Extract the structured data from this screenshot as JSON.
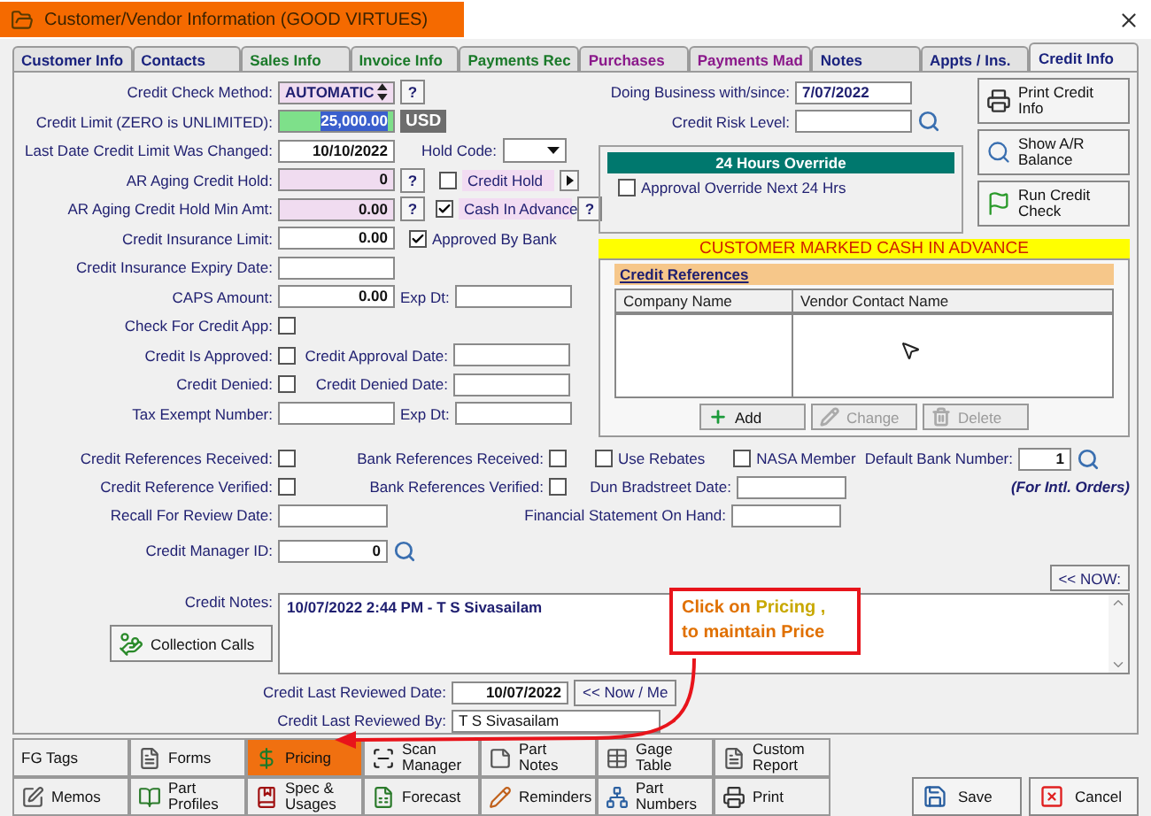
{
  "window": {
    "title": "Customer/Vendor Information  (GOOD VIRTUES)"
  },
  "tabs": [
    {
      "label": "Customer Info",
      "color": "#1a237e",
      "selected": false
    },
    {
      "label": "Contacts",
      "color": "#1a237e",
      "selected": false
    },
    {
      "label": "Sales Info",
      "color": "#1b7a2a",
      "selected": false
    },
    {
      "label": "Invoice Info",
      "color": "#1b7a2a",
      "selected": false
    },
    {
      "label": "Payments Rec",
      "color": "#1b7a2a",
      "selected": false
    },
    {
      "label": "Purchases",
      "color": "#8b1a8b",
      "selected": false
    },
    {
      "label": "Payments Mad",
      "color": "#8b1a8b",
      "selected": false
    },
    {
      "label": "Notes",
      "color": "#1a237e",
      "selected": false
    },
    {
      "label": "Appts / Ins.",
      "color": "#1a237e",
      "selected": false
    },
    {
      "label": "Credit Info",
      "color": "#1a237e",
      "selected": true
    }
  ],
  "credit_check_method": {
    "label": "Credit Check Method:",
    "value": "AUTOMATIC",
    "help": "?"
  },
  "credit_limit": {
    "label": "Credit Limit (ZERO is UNLIMITED):",
    "value": "25,000.00",
    "currency": "USD"
  },
  "limit_changed": {
    "label": "Last Date Credit Limit Was Changed:",
    "value": "10/10/2022"
  },
  "hold_code": {
    "label": "Hold Code:"
  },
  "ar_aging_hold": {
    "label": "AR Aging Credit Hold:",
    "value": "0",
    "help": "?"
  },
  "credit_hold": {
    "label": "Credit Hold",
    "checked": false
  },
  "ar_aging_min": {
    "label": "AR Aging Credit Hold Min Amt:",
    "value": "0.00",
    "help": "?"
  },
  "cash_in_advance": {
    "label": "Cash In Advance",
    "checked": true,
    "help": "?"
  },
  "insurance_limit": {
    "label": "Credit Insurance Limit:",
    "value": "0.00"
  },
  "approved_by_bank": {
    "label": "Approved By Bank",
    "checked": true
  },
  "left_rows": [
    {
      "label": "Credit Insurance Expiry Date:",
      "kind": "input"
    },
    {
      "label": "CAPS Amount:",
      "kind": "input",
      "value": "0.00",
      "sub_label": "Exp Dt:"
    },
    {
      "label": "Check For Credit App:",
      "kind": "checkbox",
      "checked": false
    },
    {
      "label": "Credit Is Approved:",
      "kind": "checkbox",
      "checked": false,
      "sub_label": "Credit Approval Date:"
    },
    {
      "label": "Credit Denied:",
      "kind": "checkbox",
      "checked": false,
      "sub_label": "Credit Denied Date:"
    },
    {
      "label": "Tax Exempt Number:",
      "kind": "input",
      "sub_label": "Exp Dt:"
    }
  ],
  "doing_business": {
    "label": "Doing Business with/since:",
    "value": "7/07/2022"
  },
  "credit_risk": {
    "label": "Credit Risk Level:"
  },
  "override": {
    "title": "24 Hours Override",
    "label": "Approval Override Next 24 Hrs",
    "checked": false
  },
  "side_buttons": [
    "Print Credit Info",
    "Show A/R Balance",
    "Run Credit Check"
  ],
  "banner": "CUSTOMER MARKED CASH IN ADVANCE",
  "credit_references": {
    "title": "Credit References",
    "columns": [
      "Company Name",
      "Vendor Contact Name"
    ],
    "buttons": [
      {
        "label": "Add",
        "disabled": false
      },
      {
        "label": "Change",
        "disabled": true
      },
      {
        "label": "Delete",
        "disabled": true
      }
    ]
  },
  "credit_refs_received": {
    "label": "Credit References Received:",
    "checked": false
  },
  "bank_refs_received": {
    "label": "Bank References Received:",
    "checked": false
  },
  "use_rebates": {
    "label": "Use Rebates",
    "checked": false
  },
  "nasa_member": {
    "label": "NASA Member",
    "checked": false
  },
  "default_bank": {
    "label": "Default Bank Number:",
    "value": "1",
    "note": "(For Intl. Orders)"
  },
  "credit_ref_verified": {
    "label": "Credit Reference Verified:",
    "checked": false
  },
  "bank_refs_verified": {
    "label": "Bank References Verified:",
    "checked": false
  },
  "dun_bradstreet": {
    "label": "Dun Bradstreet Date:"
  },
  "recall_review": {
    "label": "Recall For Review Date:"
  },
  "financial_statement": {
    "label": "Financial Statement On Hand:"
  },
  "credit_manager": {
    "label": "Credit Manager ID:",
    "value": "0"
  },
  "now_button": "<< NOW:",
  "credit_notes": {
    "label": "Credit Notes:",
    "value": "10/07/2022  2:44 PM - T S Sivasailam"
  },
  "collection_calls": "Collection Calls",
  "last_reviewed_date": {
    "label": "Credit Last Reviewed Date:",
    "value": "10/07/2022",
    "button": "<< Now / Me"
  },
  "last_reviewed_by": {
    "label": "Credit Last Reviewed By:",
    "value": "T S Sivasailam"
  },
  "annotation": {
    "prefix": "Click on",
    "highlight": "Pricing ,",
    "line2": "to maintain Price"
  },
  "bottom_buttons": [
    {
      "label": "FG Tags",
      "selected": false
    },
    {
      "label": "Forms",
      "selected": false
    },
    {
      "label": "Pricing",
      "selected": true
    },
    {
      "label": "Scan Manager",
      "selected": false
    },
    {
      "label": "Part Notes",
      "selected": false
    },
    {
      "label": "Gage Table",
      "selected": false
    },
    {
      "label": "Custom Report",
      "selected": false
    },
    {
      "label": "Memos",
      "selected": false
    },
    {
      "label": "Part Profiles",
      "selected": false
    },
    {
      "label": "Spec & Usages",
      "selected": false
    },
    {
      "label": "Forecast",
      "selected": false
    },
    {
      "label": "Reminders",
      "selected": false
    },
    {
      "label": "Part Numbers",
      "selected": false
    },
    {
      "label": "Print",
      "selected": false
    }
  ],
  "save": "Save",
  "cancel": "Cancel"
}
